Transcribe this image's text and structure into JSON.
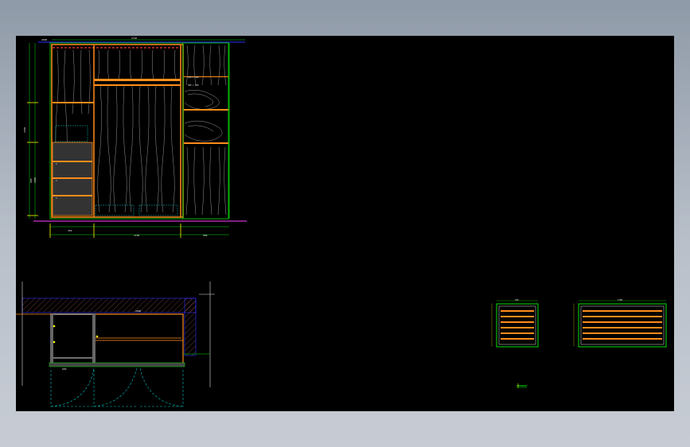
{
  "viewer": {
    "background": "#000000",
    "frame": "#9aa4b1"
  },
  "elevation": {
    "top_dims": [
      "2600",
      "2740"
    ],
    "side_dims": [
      "2400",
      "900",
      "1800"
    ],
    "bottom_dims": [
      "450",
      "1150",
      "900"
    ],
    "shelf_labels": [
      "450 x 300",
      "480 x 600",
      "5",
      "4",
      "3"
    ]
  },
  "plan": {
    "width_label": "2600",
    "depth_label": "600"
  },
  "details": {
    "left_label": "450",
    "right_label": "1100"
  },
  "colors": {
    "cabinet": "#ff8c1a",
    "guides": "#00e000",
    "dims": "#e6e6e6",
    "wall": "#3030ff",
    "magenta": "#ff40ff",
    "door": "#00c0c0"
  }
}
